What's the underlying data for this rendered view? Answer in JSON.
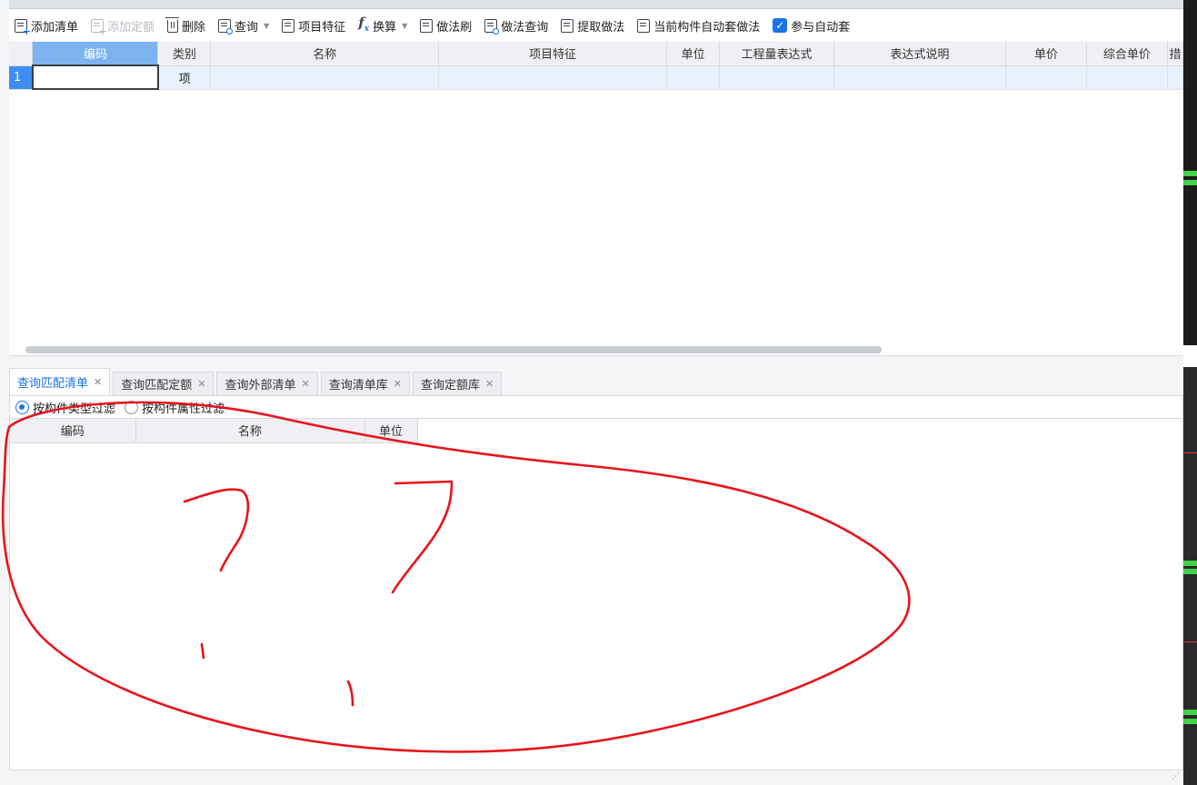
{
  "toolbar": {
    "add_list": "添加清单",
    "add_quota": "添加定额",
    "delete": "删除",
    "query": "查询",
    "item_features": "项目特征",
    "convert": "换算",
    "method_brush": "做法刷",
    "method_query": "做法查询",
    "extract_method": "提取做法",
    "auto_method": "当前构件自动套做法",
    "participate_auto": "参与自动套",
    "participate_checked": true
  },
  "upper_table": {
    "headers": [
      "编码",
      "类别",
      "名称",
      "项目特征",
      "单位",
      "工程量表达式",
      "表达式说明",
      "单价",
      "综合单价",
      "措"
    ],
    "rows": [
      {
        "num": "1",
        "code": "",
        "category": "项",
        "name": "",
        "features": "",
        "unit": "",
        "expr": "",
        "expr_desc": "",
        "price": "",
        "comp_price": ""
      }
    ]
  },
  "lower_tabs": [
    {
      "label": "查询匹配清单",
      "active": true
    },
    {
      "label": "查询匹配定额",
      "active": false
    },
    {
      "label": "查询外部清单",
      "active": false
    },
    {
      "label": "查询清单库",
      "active": false
    },
    {
      "label": "查询定额库",
      "active": false
    }
  ],
  "filters": {
    "by_type": "按构件类型过滤",
    "by_attr": "按构件属性过滤"
  },
  "lower_table": {
    "headers": [
      "编码",
      "名称",
      "单位"
    ]
  },
  "colors": {
    "accent": "#1a73e8",
    "annotation": "#e8141c"
  }
}
